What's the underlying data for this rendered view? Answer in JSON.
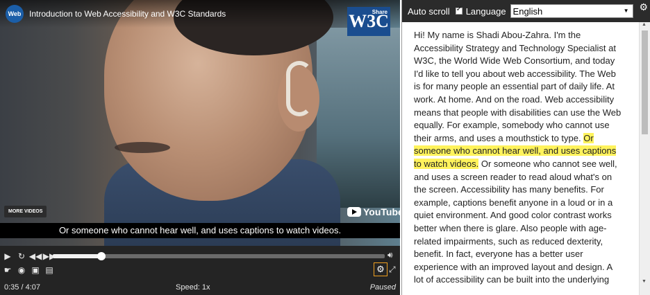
{
  "player": {
    "channel_logo_text": "Web",
    "title": "Introduction to Web Accessibility and W3C Standards",
    "w3c_logo_text": "W3C",
    "w3c_share_text": "Share",
    "more_videos_label": "MORE VIDEOS",
    "youtube_label": "YouTube",
    "caption_text": "Or someone who cannot hear well, and uses captions to watch videos.",
    "progress_fraction": 0.147,
    "controls": {
      "play_icon": "play-icon",
      "restart_icon": "restart-icon",
      "rewind_icon": "rewind-icon",
      "forward_icon": "fast-forward-icon",
      "volume_icon": "volume-icon",
      "row2_icons": [
        "sign-language-icon",
        "audio-description-icon",
        "captions-icon",
        "transcript-icon"
      ],
      "settings_icon": "gear-icon",
      "fullscreen_icon": "fullscreen-icon"
    },
    "status": {
      "elapsed": "0:35 / 4:07",
      "speed": "Speed: 1x",
      "state": "Paused"
    }
  },
  "transcript": {
    "auto_scroll_label": "Auto scroll",
    "auto_scroll_checked": true,
    "language_label": "Language",
    "language_value": "English",
    "settings_icon": "gear-icon",
    "text_before": "Hi! My name is Shadi Abou-Zahra. I'm the Accessibility Strategy and Technology Specialist at W3C, the World Wide Web Consortium, and today I'd like to tell you about web accessibility. The Web is for many people an essential part of daily life. At work. At home. And on the road. Web accessibility means that people with disabilities can use the Web equally. For example, somebody who cannot use their arms, and uses a mouthstick to type. ",
    "text_highlight": "Or someone who cannot hear well, and uses captions to watch videos.",
    "text_after": " Or someone who cannot see well, and uses a screen reader to read aloud what's on the screen. Accessibility has many benefits. For example, captions benefit anyone in a loud or in a quiet environment. And good color contrast works better when there is glare. Also people with age-related impairments, such as reduced dexterity, benefit. In fact, everyone has a better user experience with an improved layout and design. A lot of accessibility can be built into the underlying",
    "colors": {
      "highlight": "#fff35c",
      "toolbar": "#2b2b2b",
      "settings_outline": "#f0a020"
    }
  }
}
